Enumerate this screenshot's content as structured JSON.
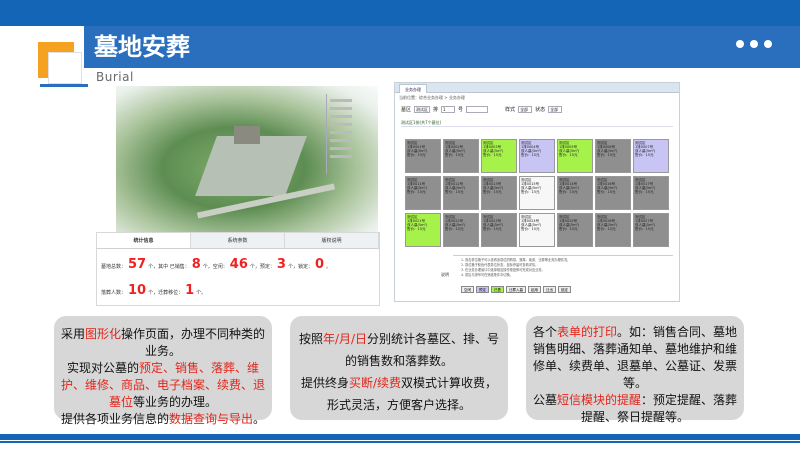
{
  "header": {
    "title": "墓地安葬",
    "subtitle": "Burial"
  },
  "colors": {
    "brand_blue": "#2a6fbe",
    "accent_orange": "#f4a21f",
    "highlight_red": "#e2261b",
    "cell_green": "#a6f24a",
    "cell_gray": "#8f8f8f",
    "cell_lavender": "#c8c4f4"
  },
  "stats_panel": {
    "tabs": [
      "统计信息",
      "系统参数",
      "版权说明"
    ],
    "row1": [
      {
        "label": "墓地总数：",
        "value": "57",
        "unit": "个，"
      },
      {
        "label": "其中 已销售：",
        "value": "8",
        "unit": "个，"
      },
      {
        "label": "空闲：",
        "value": "46",
        "unit": "个，"
      },
      {
        "label": "预定：",
        "value": "3",
        "unit": "个，"
      },
      {
        "label": "锁定：",
        "value": "0",
        "unit": "。"
      }
    ],
    "row2": [
      {
        "label": "落葬人数：",
        "value": "10",
        "unit": "个，"
      },
      {
        "label": "迁葬移位：",
        "value": "1",
        "unit": "个。"
      }
    ]
  },
  "software": {
    "tab": "业务办理",
    "breadcrumb": "当前位置：综合业务办理 > 业务办理",
    "filter": {
      "zone_label": "墓区",
      "zone_value": "测试区",
      "row_label": "排",
      "row_value": "1",
      "number_label": "号",
      "style_label": "样式",
      "style_value": "全部",
      "status_label": "状态",
      "status_value": "全部"
    },
    "zone_header": "测试区1排(共7个墓位)",
    "cells": [
      {
        "color": "c-gray",
        "lines": [
          "测试区",
          "1排0001号",
          "双人墓(5m²)",
          "售价：15元"
        ]
      },
      {
        "color": "c-gray",
        "lines": [
          "测试区",
          "1排0002号",
          "双人墓(5m²)",
          "售价：15元"
        ]
      },
      {
        "color": "c-green",
        "lines": [
          "测试区",
          "1排0003号",
          "双人墓(5m²)",
          "售价：15元"
        ]
      },
      {
        "color": "c-lav",
        "lines": [
          "测试区",
          "1排0004号",
          "双人墓(5m²)",
          "售价：15元"
        ]
      },
      {
        "color": "c-green",
        "lines": [
          "测试区",
          "1排0005号",
          "双人墓(5m²)",
          "售价：15元"
        ]
      },
      {
        "color": "c-gray",
        "lines": [
          "测试区",
          "1排0006号",
          "双人墓(5m²)",
          "售价：15元"
        ]
      },
      {
        "color": "c-lav",
        "lines": [
          "测试区",
          "1排0007号",
          "双人墓(5m²)",
          "售价：15元"
        ]
      },
      {
        "color": "c-gray",
        "lines": [
          "测试区",
          "1排0011号",
          "双人墓(5m²)",
          "售价：15元"
        ]
      },
      {
        "color": "c-gray",
        "lines": [
          "测试区",
          "1排0012号",
          "双人墓(5m²)",
          "售价：15元"
        ]
      },
      {
        "color": "c-gray",
        "lines": [
          "测试区",
          "1排0013号",
          "双人墓(5m²)",
          "售价：15元"
        ]
      },
      {
        "color": "c-white",
        "lines": [
          "测试区",
          "1排0015号",
          "双人墓(5m²)",
          "售价：15元"
        ]
      },
      {
        "color": "c-gray",
        "lines": [
          "测试区",
          "1排0014号",
          "双人墓(5m²)",
          "售价：15元"
        ]
      },
      {
        "color": "c-gray",
        "lines": [
          "测试区",
          "1排0016号",
          "双人墓(5m²)",
          "售价：15元"
        ]
      },
      {
        "color": "c-gray",
        "lines": [
          "测试区",
          "1排0017号",
          "双人墓(5m²)",
          "售价：15元"
        ]
      },
      {
        "color": "c-green",
        "lines": [
          "测试区",
          "1排0021号",
          "双人墓(5m²)",
          "售价：15元"
        ]
      },
      {
        "color": "c-gray",
        "lines": [
          "测试区",
          "1排0022号",
          "双人墓(5m²)",
          "售价：15元"
        ]
      },
      {
        "color": "c-gray",
        "lines": [
          "测试区",
          "1排0023号",
          "双人墓(5m²)",
          "售价：15元"
        ]
      },
      {
        "color": "c-white",
        "lines": [
          "测试区",
          "1排0024号",
          "双人墓(5m²)",
          "售价：15元"
        ]
      },
      {
        "color": "c-gray",
        "lines": [
          "测试区",
          "1排0025号",
          "双人墓(5m²)",
          "售价：15元"
        ]
      },
      {
        "color": "c-gray",
        "lines": [
          "测试区",
          "1排0026号",
          "双人墓(5m²)",
          "售价：15元"
        ]
      },
      {
        "color": "c-gray",
        "lines": [
          "测试区",
          "1排0027号",
          "双人墓(5m²)",
          "售价：15元"
        ]
      }
    ],
    "bottom_label": "说明",
    "notes": [
      "1. 双击墓位格子可以查看该墓位的购墓、落葬、续费、迁葬等业务办理情况。",
      "2. 墓位格子颜色代表墓位状态，鼠标停留可查看详情。",
      "3. 在业务办理窗口中选择相应操作按钮即可完成对应业务。",
      "4. 墓区与排号可在筛选条件中切换。"
    ],
    "buttons": [
      {
        "label": "空闲",
        "style": ""
      },
      {
        "label": "预定",
        "style": "l"
      },
      {
        "label": "已售",
        "style": "g"
      },
      {
        "label": "迁葬入墓",
        "style": ""
      },
      {
        "label": "起用",
        "style": ""
      },
      {
        "label": "迁出",
        "style": ""
      },
      {
        "label": "锁定",
        "style": ""
      }
    ]
  },
  "boxes": {
    "box1": [
      [
        {
          "t": "采用"
        },
        {
          "t": "图形化",
          "h": true
        },
        {
          "t": "操作页面，办理不同种类的业务。"
        }
      ],
      [
        {
          "t": "实现对公墓的"
        },
        {
          "t": "预定、销售、落葬、维护、维修、商品、电子档案、续费、退墓位",
          "h": true
        },
        {
          "t": "等业务的办理。"
        }
      ],
      [
        {
          "t": "提供各项业务信息的"
        },
        {
          "t": "数据查询与导出",
          "h": true
        },
        {
          "t": "。"
        }
      ]
    ],
    "box2": [
      [
        {
          "t": "按照"
        },
        {
          "t": "年/月/日",
          "h": true
        },
        {
          "t": "分别统计各墓区、排、号的销售数和落葬数。"
        }
      ],
      [
        {
          "t": "提供终身"
        },
        {
          "t": "买断/续费",
          "h": true
        },
        {
          "t": "双模式计算收费，形式灵活，方便客户选择。"
        }
      ]
    ],
    "box3": [
      [
        {
          "t": "各个"
        },
        {
          "t": "表单的打印",
          "h": true
        },
        {
          "t": "。如：销售合同、墓地销售明细、落葬通知单、墓地维护和维修单、续费单、退墓单、公墓证、发票等。"
        }
      ],
      [
        {
          "t": "公墓"
        },
        {
          "t": "短信模块的提醒",
          "h": true
        },
        {
          "t": "：预定提醒、落葬提醒、祭日提醒等。"
        }
      ]
    ]
  }
}
